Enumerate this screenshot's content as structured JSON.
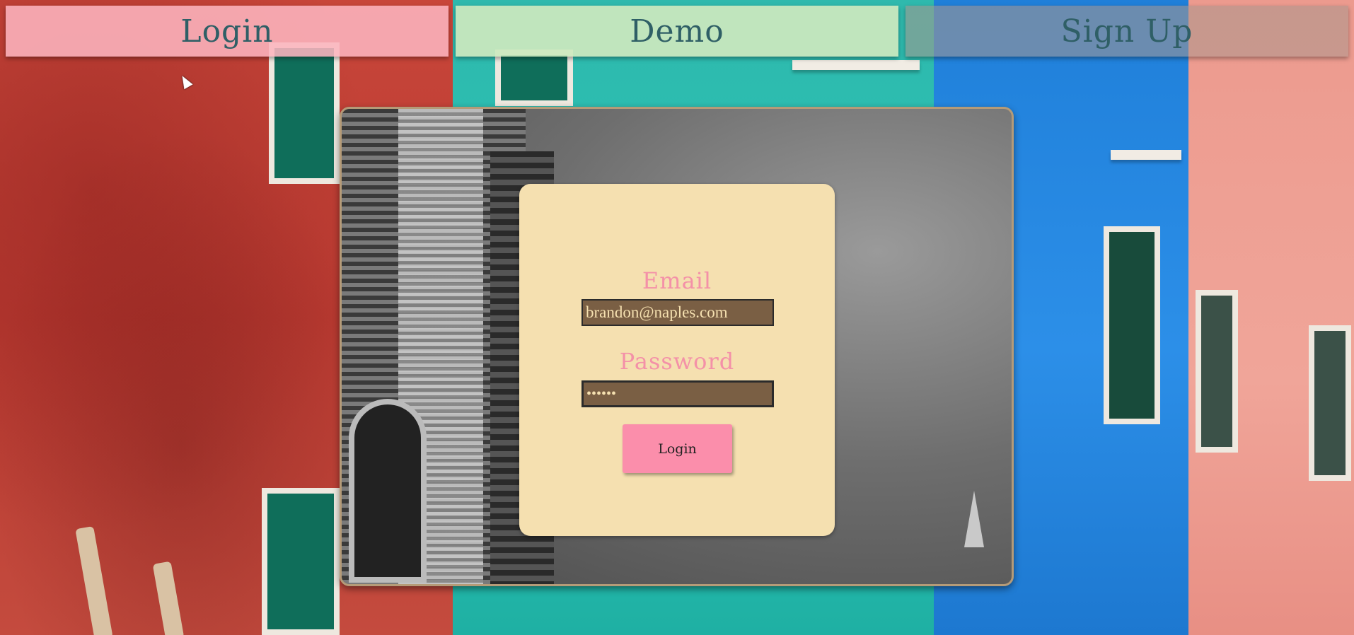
{
  "nav": {
    "login_label": "Login",
    "demo_label": "Demo",
    "signup_label": "Sign Up"
  },
  "form": {
    "email_label": "Email",
    "email_value": "brandon@naples.com",
    "password_label": "Password",
    "password_value": "••••••",
    "submit_label": "Login"
  },
  "colors": {
    "card_bg": "#f5e0b0",
    "label_pink": "#f491a8",
    "button_pink": "#fb8eab",
    "field_bg": "#7a5f44",
    "nav_text": "#2f5f66"
  }
}
